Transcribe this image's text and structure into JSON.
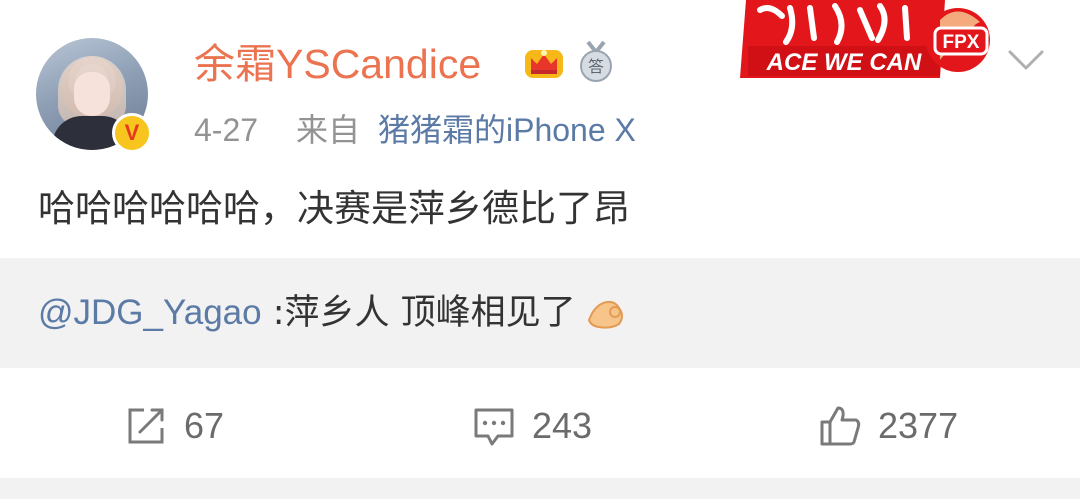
{
  "post": {
    "author": "余霜YSCandice",
    "time": "4-27",
    "from_label": "来自",
    "source": "猪猪霜的iPhone X",
    "text": "哈哈哈哈哈哈，决赛是萍乡德比了昂",
    "badges": {
      "medal_text": "答"
    }
  },
  "banner": {
    "slogan": "ACE WE CAN",
    "team": "FPX"
  },
  "repost": {
    "user": "@JDG_Yagao",
    "text": " :萍乡人 顶峰相见了"
  },
  "actions": {
    "repost_count": "67",
    "comment_count": "243",
    "like_count": "2377"
  },
  "colors": {
    "username": "#eb7350",
    "link": "#5b7aa6",
    "meta": "#939393",
    "repost_bg": "#f2f2f2"
  },
  "icons": [
    "verified-v-icon",
    "crown-icon",
    "medal-icon",
    "chevron-down-icon",
    "ok-hand-icon",
    "repost-icon",
    "comment-icon",
    "like-icon"
  ]
}
